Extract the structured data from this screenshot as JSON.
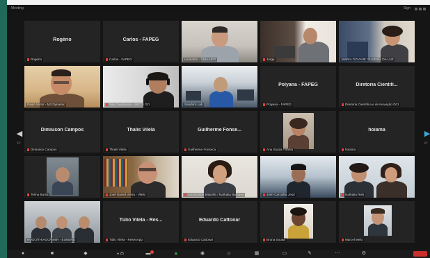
{
  "window": {
    "title_left": "Meeting",
    "title_right": "Sign"
  },
  "nav": {
    "left_arrow": "◀",
    "right_arrow": "▶",
    "left_page": "1/2",
    "right_page": "1/2"
  },
  "tiles": [
    {
      "name": "Rogério",
      "caption": "Rogério",
      "video": false
    },
    {
      "name": "Carlos - FAPEG",
      "caption": "Carlos - FAPEG",
      "video": false
    },
    {
      "name": "",
      "caption": "Leonardo - CEIA-UFG",
      "video": true
    },
    {
      "name": "",
      "caption": "Jorge",
      "video": true
    },
    {
      "name": "",
      "caption": "MARIA GOVANE OLIVEIRA DA LUZ",
      "video": true
    },
    {
      "name": "",
      "caption": "Paulo Victor - M2 Dynamic",
      "video": true,
      "active": true
    },
    {
      "name": "",
      "caption": "Yan Cavalcante - SECTI GO",
      "video": true
    },
    {
      "name": "",
      "caption": "Sandoro Lab",
      "video": true
    },
    {
      "name": "Polyana - FAPEG",
      "caption": "Polyana - FAPEG",
      "video": false
    },
    {
      "name": "Diretoria Cientifi...",
      "caption": "Diretoria Científica e de Inovação DCI",
      "video": false
    },
    {
      "name": "Dimiuson Campos",
      "caption": "Dimiuson Campos",
      "video": false
    },
    {
      "name": "Thalis Vilela",
      "caption": "Thalis Vilela",
      "video": false
    },
    {
      "name": "Guilherme Fonse...",
      "caption": "Guilherme Fonseca",
      "video": false
    },
    {
      "name": "",
      "caption": "Ana Souza / Bahia",
      "video": true
    },
    {
      "name": "hoiama",
      "caption": "hoiama",
      "video": false
    },
    {
      "name": "",
      "caption": "Telma Barto",
      "video": true
    },
    {
      "name": "",
      "caption": "José Daniel Vieira - Vilelo",
      "video": true
    },
    {
      "name": "",
      "caption": "LúciaGrijon Bitarello / Nathalia Barbosa",
      "video": true
    },
    {
      "name": "",
      "caption": "Jorin Carcalha Jesd",
      "video": true
    },
    {
      "name": "",
      "caption": "Nathalia Reis",
      "video": true
    },
    {
      "name": "",
      "caption": "HUGO/THIAGO/AMIR - EUNERO",
      "video": true
    },
    {
      "name": "Túlio Vilela - Res...",
      "caption": "Túlio Vilela - ResenApp",
      "video": false
    },
    {
      "name": "Eduardo Cattonar",
      "caption": "Eduardo Cattonar",
      "video": false
    },
    {
      "name": "",
      "caption": "Bruna Sousa",
      "video": true
    },
    {
      "name": "",
      "caption": "Marcel Melo",
      "video": true
    }
  ],
  "toolbar": {
    "participants_count": "25"
  },
  "colors": {
    "active_speaker": "#e6cf3a",
    "muted": "#e0443a",
    "end_button": "#c9302c"
  }
}
